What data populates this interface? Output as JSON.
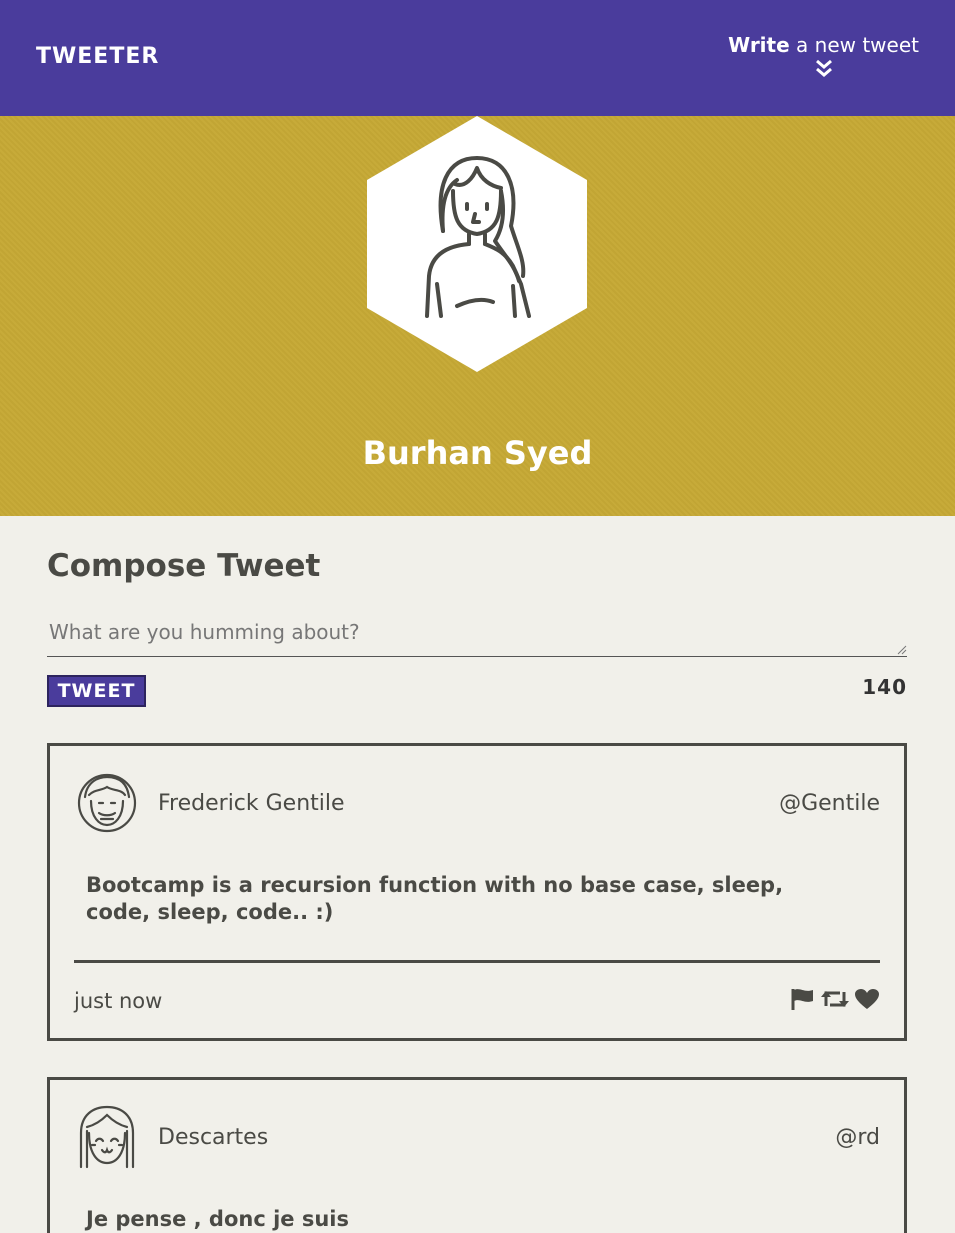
{
  "nav": {
    "brand": "TWEETER",
    "write_bold": "Write",
    "write_rest": " a new tweet",
    "chevron_icon": "double-chevron-down-icon"
  },
  "profile": {
    "name": "Burhan Syed",
    "avatar_icon": "woman-avatar-icon",
    "banner_color": "#c6a935"
  },
  "compose": {
    "title": "Compose Tweet",
    "placeholder": "What are you humming about?",
    "value": "",
    "button_label": "TWEET",
    "counter": "140"
  },
  "tweets": [
    {
      "name": "Frederick Gentile",
      "handle": "@Gentile",
      "text": "Bootcamp is a recursion function with no base case, sleep, code, sleep, code.. :)",
      "time": "just now",
      "avatar_icon": "man-avatar-icon"
    },
    {
      "name": "Descartes",
      "handle": "@rd",
      "text": "Je pense , donc je suis",
      "avatar_icon": "girl-avatar-icon"
    }
  ],
  "colors": {
    "nav": "#4a3c9c",
    "banner": "#c6a935",
    "background": "#f1f0ea",
    "text": "#4a4a45"
  }
}
